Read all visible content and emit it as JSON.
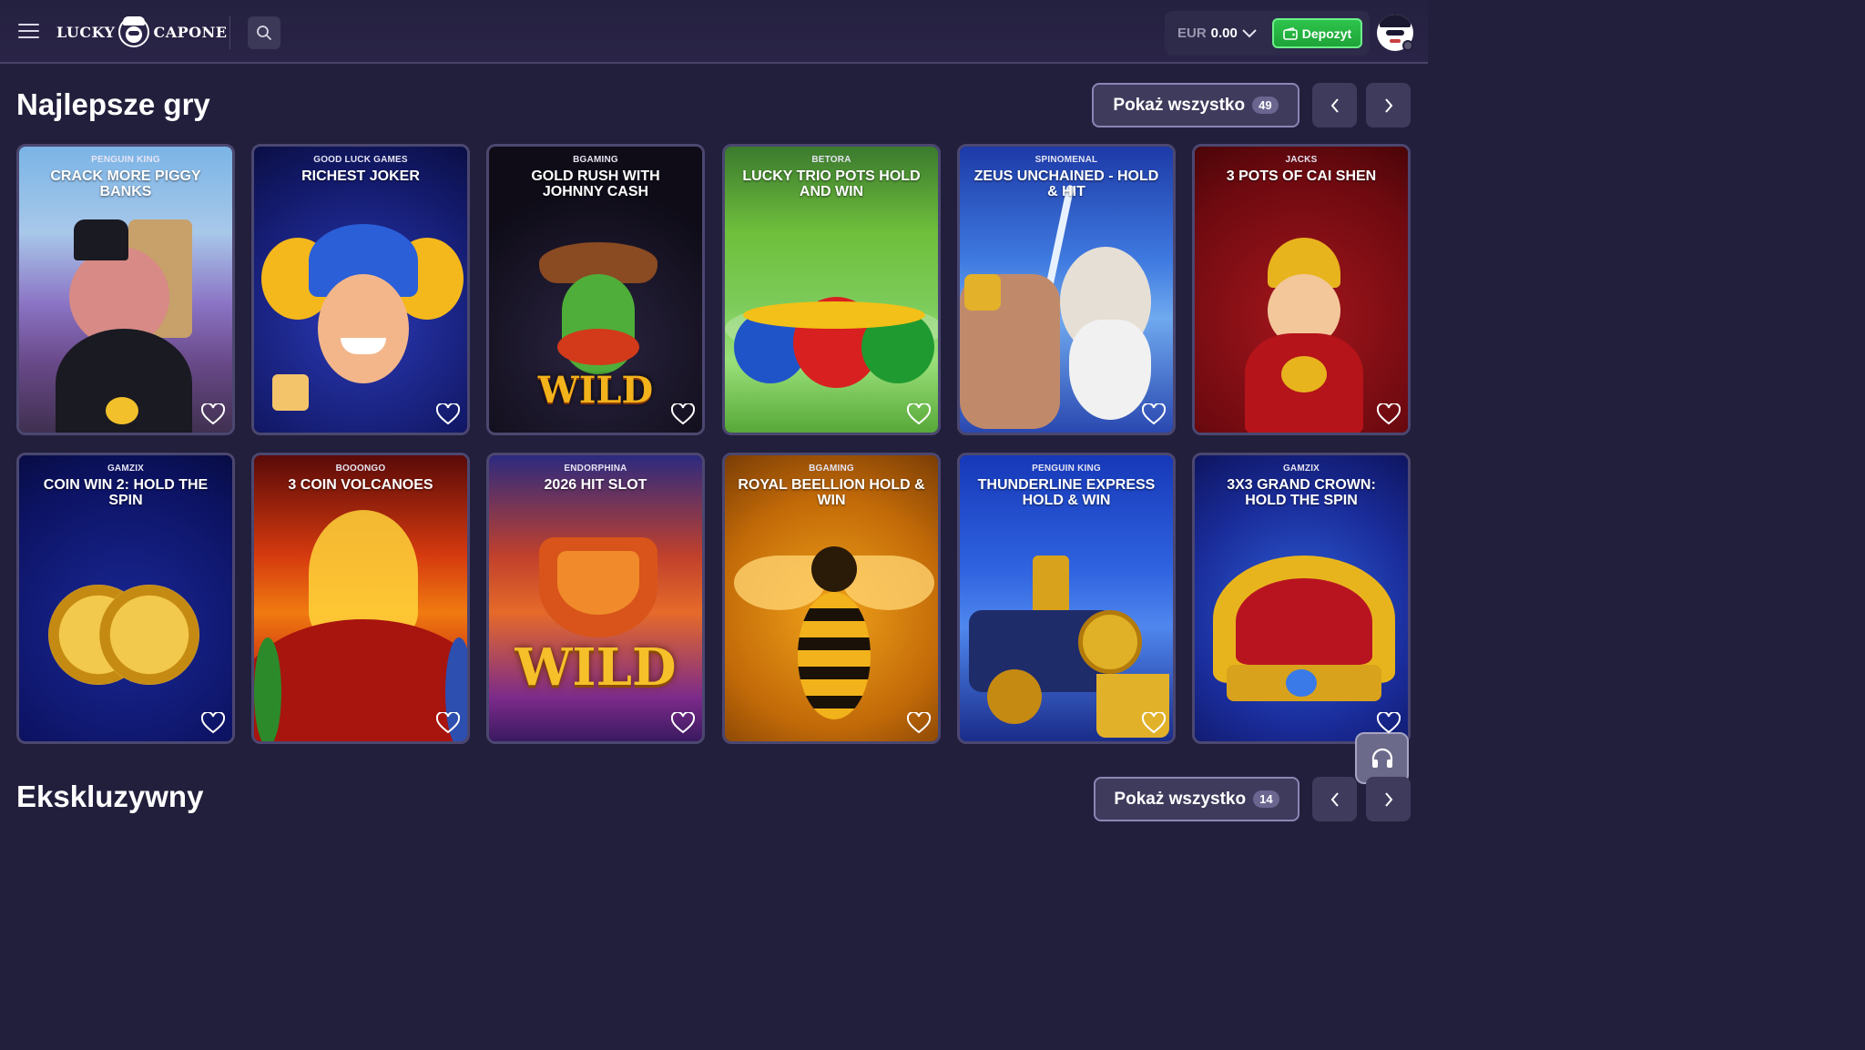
{
  "header": {
    "logo_left": "LUCKY",
    "logo_right": "CAPONE",
    "balance_currency": "EUR",
    "balance_amount": "0.00",
    "deposit_label": "Depozyt"
  },
  "section": {
    "title": "Najlepsze gry",
    "show_all_label": "Pokaż wszystko",
    "show_all_count": "49"
  },
  "games": [
    {
      "provider": "PENGUIN KING",
      "name": "CRACK MORE PIGGY BANKS"
    },
    {
      "provider": "GOOD LUCK GAMES",
      "name": "RICHEST JOKER"
    },
    {
      "provider": "BGAMING",
      "name": "GOLD RUSH WITH JOHNNY CASH"
    },
    {
      "provider": "BETORA",
      "name": "LUCKY TRIO POTS HOLD AND WIN"
    },
    {
      "provider": "SPINOMENAL",
      "name": "ZEUS UNCHAINED - HOLD & HIT"
    },
    {
      "provider": "JACKS",
      "name": "3 POTS OF CAI SHEN"
    },
    {
      "provider": "GAMZIX",
      "name": "COIN WIN 2: HOLD THE SPIN"
    },
    {
      "provider": "BOOONGO",
      "name": "3 COIN VOLCANOES"
    },
    {
      "provider": "ENDORPHINA",
      "name": "2026 HIT SLOT"
    },
    {
      "provider": "BGAMING",
      "name": "ROYAL BEELLION HOLD & WIN"
    },
    {
      "provider": "PENGUIN KING",
      "name": "THUNDERLINE EXPRESS HOLD & WIN"
    },
    {
      "provider": "GAMZIX",
      "name": "3X3 GRAND CROWN: HOLD THE SPIN"
    }
  ],
  "art_text": {
    "wild_cowboy": "WILD",
    "wild_slot": "WILD"
  },
  "section2": {
    "title": "Ekskluzywny",
    "show_all_label": "Pokaż wszystko",
    "show_all_count": "14"
  },
  "icons": {
    "menu": "hamburger-icon",
    "search": "search-icon",
    "deposit": "wallet-icon",
    "dropdown": "chevron-down-icon",
    "favorite": "heart-icon",
    "support": "headset-icon"
  },
  "colors": {
    "background": "#221f3c",
    "deposit_green": "#2ec44c",
    "card_border": "#4b4770"
  }
}
